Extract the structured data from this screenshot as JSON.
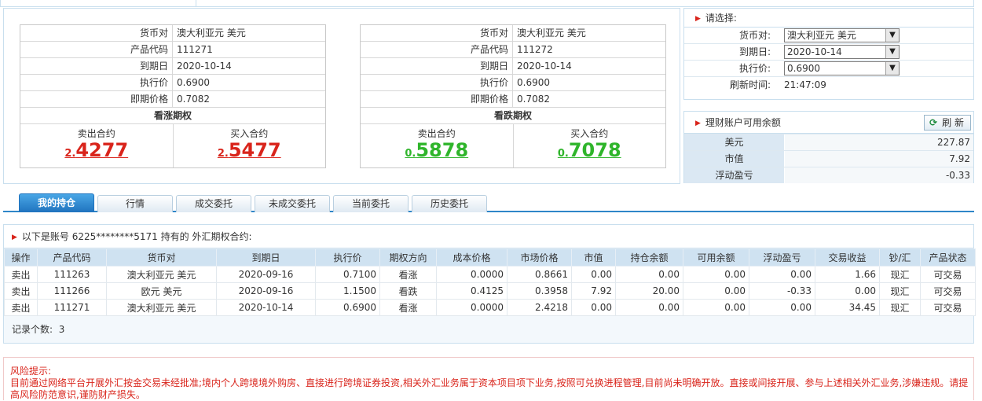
{
  "quote_call": {
    "rows": [
      {
        "label": "货币对",
        "value": "澳大利亚元 美元"
      },
      {
        "label": "产品代码",
        "value": "111271"
      },
      {
        "label": "到期日",
        "value": "2020-10-14"
      },
      {
        "label": "执行价",
        "value": "0.6900"
      },
      {
        "label": "即期价格",
        "value": "0.7082"
      }
    ],
    "title": "看涨期权",
    "sell_label": "卖出合约",
    "sell_price_small": "2.",
    "sell_price_large": "4277",
    "buy_label": "买入合约",
    "buy_price_small": "2.",
    "buy_price_large": "5477",
    "price_color": "#d9241b"
  },
  "quote_put": {
    "rows": [
      {
        "label": "货币对",
        "value": "澳大利亚元 美元"
      },
      {
        "label": "产品代码",
        "value": "111272"
      },
      {
        "label": "到期日",
        "value": "2020-10-14"
      },
      {
        "label": "执行价",
        "value": "0.6900"
      },
      {
        "label": "即期价格",
        "value": "0.7082"
      }
    ],
    "title": "看跌期权",
    "sell_label": "卖出合约",
    "sell_price_small": "0.",
    "sell_price_large": "5878",
    "buy_label": "买入合约",
    "buy_price_small": "0.",
    "buy_price_large": "7078",
    "price_color": "#2fb52b"
  },
  "selector": {
    "header": "请选择:",
    "currency_label": "货币对:",
    "currency_value": "澳大利亚元 美元",
    "expiry_label": "到期日:",
    "expiry_value": "2020-10-14",
    "strike_label": "执行价:",
    "strike_value": "0.6900",
    "refresh_time_label": "刷新时间:",
    "refresh_time_value": "21:47:09"
  },
  "account": {
    "header": "理财账户可用余额",
    "refresh_button": "刷 新",
    "rows": [
      {
        "label": "美元",
        "value": "227.87"
      },
      {
        "label": "市值",
        "value": "7.92"
      },
      {
        "label": "浮动盈亏",
        "value": "-0.33"
      }
    ]
  },
  "tabs": [
    {
      "label": "我的持仓",
      "active": true
    },
    {
      "label": "行情",
      "active": false
    },
    {
      "label": "成交委托",
      "active": false
    },
    {
      "label": "未成交委托",
      "active": false
    },
    {
      "label": "当前委托",
      "active": false
    },
    {
      "label": "历史委托",
      "active": false
    }
  ],
  "holdings": {
    "caption": "以下是账号 6225********5171 持有的 外汇期权合约:",
    "columns": [
      "操作",
      "产品代码",
      "货币对",
      "到期日",
      "执行价",
      "期权方向",
      "成本价格",
      "市场价格",
      "市值",
      "持仓余额",
      "可用余额",
      "浮动盈亏",
      "交易收益",
      "钞/汇",
      "产品状态"
    ],
    "rows": [
      [
        "卖出",
        "111263",
        "澳大利亚元 美元",
        "2020-09-16",
        "0.7100",
        "看涨",
        "0.0000",
        "0.8661",
        "0.00",
        "0.00",
        "0.00",
        "0.00",
        "1.66",
        "现汇",
        "可交易"
      ],
      [
        "卖出",
        "111266",
        "欧元 美元",
        "2020-09-16",
        "1.1500",
        "看跌",
        "0.4125",
        "0.3958",
        "7.92",
        "20.00",
        "0.00",
        "-0.33",
        "0.00",
        "现汇",
        "可交易"
      ],
      [
        "卖出",
        "111271",
        "澳大利亚元 美元",
        "2020-10-14",
        "0.6900",
        "看涨",
        "0.0000",
        "2.4218",
        "0.00",
        "0.00",
        "0.00",
        "0.00",
        "34.45",
        "现汇",
        "可交易"
      ]
    ],
    "count_label": "记录个数:",
    "count_value": "3"
  },
  "risk": {
    "title": "风险提示:",
    "text": "目前通过网络平台开展外汇按金交易未经批准;境内个人跨境境外购房、直接进行跨境证券投资,相关外汇业务属于资本项目项下业务,按照可兑换进程管理,目前尚未明确开放。直接或间接开展、参与上述相关外汇业务,涉嫌违规。请提高风险防范意识,谨防财产损失。"
  }
}
